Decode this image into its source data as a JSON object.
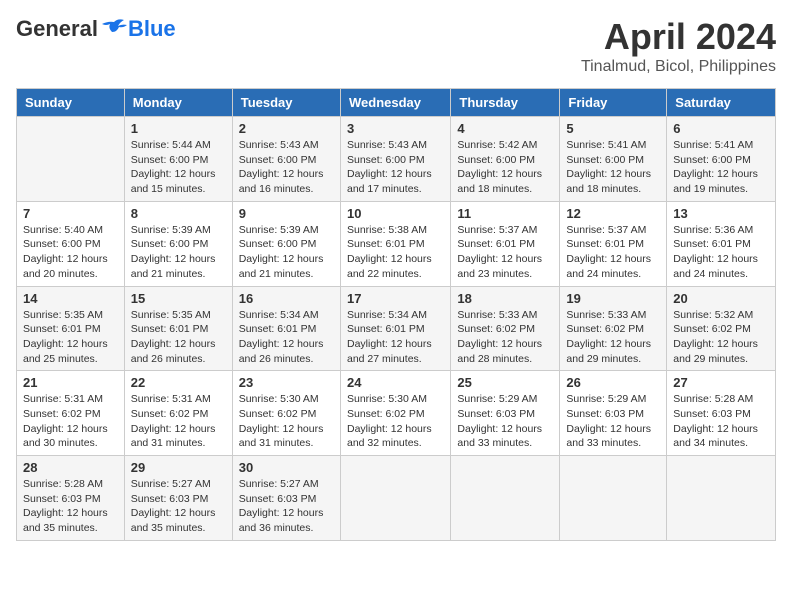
{
  "header": {
    "logo": {
      "general": "General",
      "blue": "Blue"
    },
    "title": "April 2024",
    "subtitle": "Tinalmud, Bicol, Philippines"
  },
  "columns": [
    "Sunday",
    "Monday",
    "Tuesday",
    "Wednesday",
    "Thursday",
    "Friday",
    "Saturday"
  ],
  "weeks": [
    [
      {
        "day": "",
        "info": ""
      },
      {
        "day": "1",
        "info": "Sunrise: 5:44 AM\nSunset: 6:00 PM\nDaylight: 12 hours\nand 15 minutes."
      },
      {
        "day": "2",
        "info": "Sunrise: 5:43 AM\nSunset: 6:00 PM\nDaylight: 12 hours\nand 16 minutes."
      },
      {
        "day": "3",
        "info": "Sunrise: 5:43 AM\nSunset: 6:00 PM\nDaylight: 12 hours\nand 17 minutes."
      },
      {
        "day": "4",
        "info": "Sunrise: 5:42 AM\nSunset: 6:00 PM\nDaylight: 12 hours\nand 18 minutes."
      },
      {
        "day": "5",
        "info": "Sunrise: 5:41 AM\nSunset: 6:00 PM\nDaylight: 12 hours\nand 18 minutes."
      },
      {
        "day": "6",
        "info": "Sunrise: 5:41 AM\nSunset: 6:00 PM\nDaylight: 12 hours\nand 19 minutes."
      }
    ],
    [
      {
        "day": "7",
        "info": "Sunrise: 5:40 AM\nSunset: 6:00 PM\nDaylight: 12 hours\nand 20 minutes."
      },
      {
        "day": "8",
        "info": "Sunrise: 5:39 AM\nSunset: 6:00 PM\nDaylight: 12 hours\nand 21 minutes."
      },
      {
        "day": "9",
        "info": "Sunrise: 5:39 AM\nSunset: 6:00 PM\nDaylight: 12 hours\nand 21 minutes."
      },
      {
        "day": "10",
        "info": "Sunrise: 5:38 AM\nSunset: 6:01 PM\nDaylight: 12 hours\nand 22 minutes."
      },
      {
        "day": "11",
        "info": "Sunrise: 5:37 AM\nSunset: 6:01 PM\nDaylight: 12 hours\nand 23 minutes."
      },
      {
        "day": "12",
        "info": "Sunrise: 5:37 AM\nSunset: 6:01 PM\nDaylight: 12 hours\nand 24 minutes."
      },
      {
        "day": "13",
        "info": "Sunrise: 5:36 AM\nSunset: 6:01 PM\nDaylight: 12 hours\nand 24 minutes."
      }
    ],
    [
      {
        "day": "14",
        "info": "Sunrise: 5:35 AM\nSunset: 6:01 PM\nDaylight: 12 hours\nand 25 minutes."
      },
      {
        "day": "15",
        "info": "Sunrise: 5:35 AM\nSunset: 6:01 PM\nDaylight: 12 hours\nand 26 minutes."
      },
      {
        "day": "16",
        "info": "Sunrise: 5:34 AM\nSunset: 6:01 PM\nDaylight: 12 hours\nand 26 minutes."
      },
      {
        "day": "17",
        "info": "Sunrise: 5:34 AM\nSunset: 6:01 PM\nDaylight: 12 hours\nand 27 minutes."
      },
      {
        "day": "18",
        "info": "Sunrise: 5:33 AM\nSunset: 6:02 PM\nDaylight: 12 hours\nand 28 minutes."
      },
      {
        "day": "19",
        "info": "Sunrise: 5:33 AM\nSunset: 6:02 PM\nDaylight: 12 hours\nand 29 minutes."
      },
      {
        "day": "20",
        "info": "Sunrise: 5:32 AM\nSunset: 6:02 PM\nDaylight: 12 hours\nand 29 minutes."
      }
    ],
    [
      {
        "day": "21",
        "info": "Sunrise: 5:31 AM\nSunset: 6:02 PM\nDaylight: 12 hours\nand 30 minutes."
      },
      {
        "day": "22",
        "info": "Sunrise: 5:31 AM\nSunset: 6:02 PM\nDaylight: 12 hours\nand 31 minutes."
      },
      {
        "day": "23",
        "info": "Sunrise: 5:30 AM\nSunset: 6:02 PM\nDaylight: 12 hours\nand 31 minutes."
      },
      {
        "day": "24",
        "info": "Sunrise: 5:30 AM\nSunset: 6:02 PM\nDaylight: 12 hours\nand 32 minutes."
      },
      {
        "day": "25",
        "info": "Sunrise: 5:29 AM\nSunset: 6:03 PM\nDaylight: 12 hours\nand 33 minutes."
      },
      {
        "day": "26",
        "info": "Sunrise: 5:29 AM\nSunset: 6:03 PM\nDaylight: 12 hours\nand 33 minutes."
      },
      {
        "day": "27",
        "info": "Sunrise: 5:28 AM\nSunset: 6:03 PM\nDaylight: 12 hours\nand 34 minutes."
      }
    ],
    [
      {
        "day": "28",
        "info": "Sunrise: 5:28 AM\nSunset: 6:03 PM\nDaylight: 12 hours\nand 35 minutes."
      },
      {
        "day": "29",
        "info": "Sunrise: 5:27 AM\nSunset: 6:03 PM\nDaylight: 12 hours\nand 35 minutes."
      },
      {
        "day": "30",
        "info": "Sunrise: 5:27 AM\nSunset: 6:03 PM\nDaylight: 12 hours\nand 36 minutes."
      },
      {
        "day": "",
        "info": ""
      },
      {
        "day": "",
        "info": ""
      },
      {
        "day": "",
        "info": ""
      },
      {
        "day": "",
        "info": ""
      }
    ]
  ]
}
